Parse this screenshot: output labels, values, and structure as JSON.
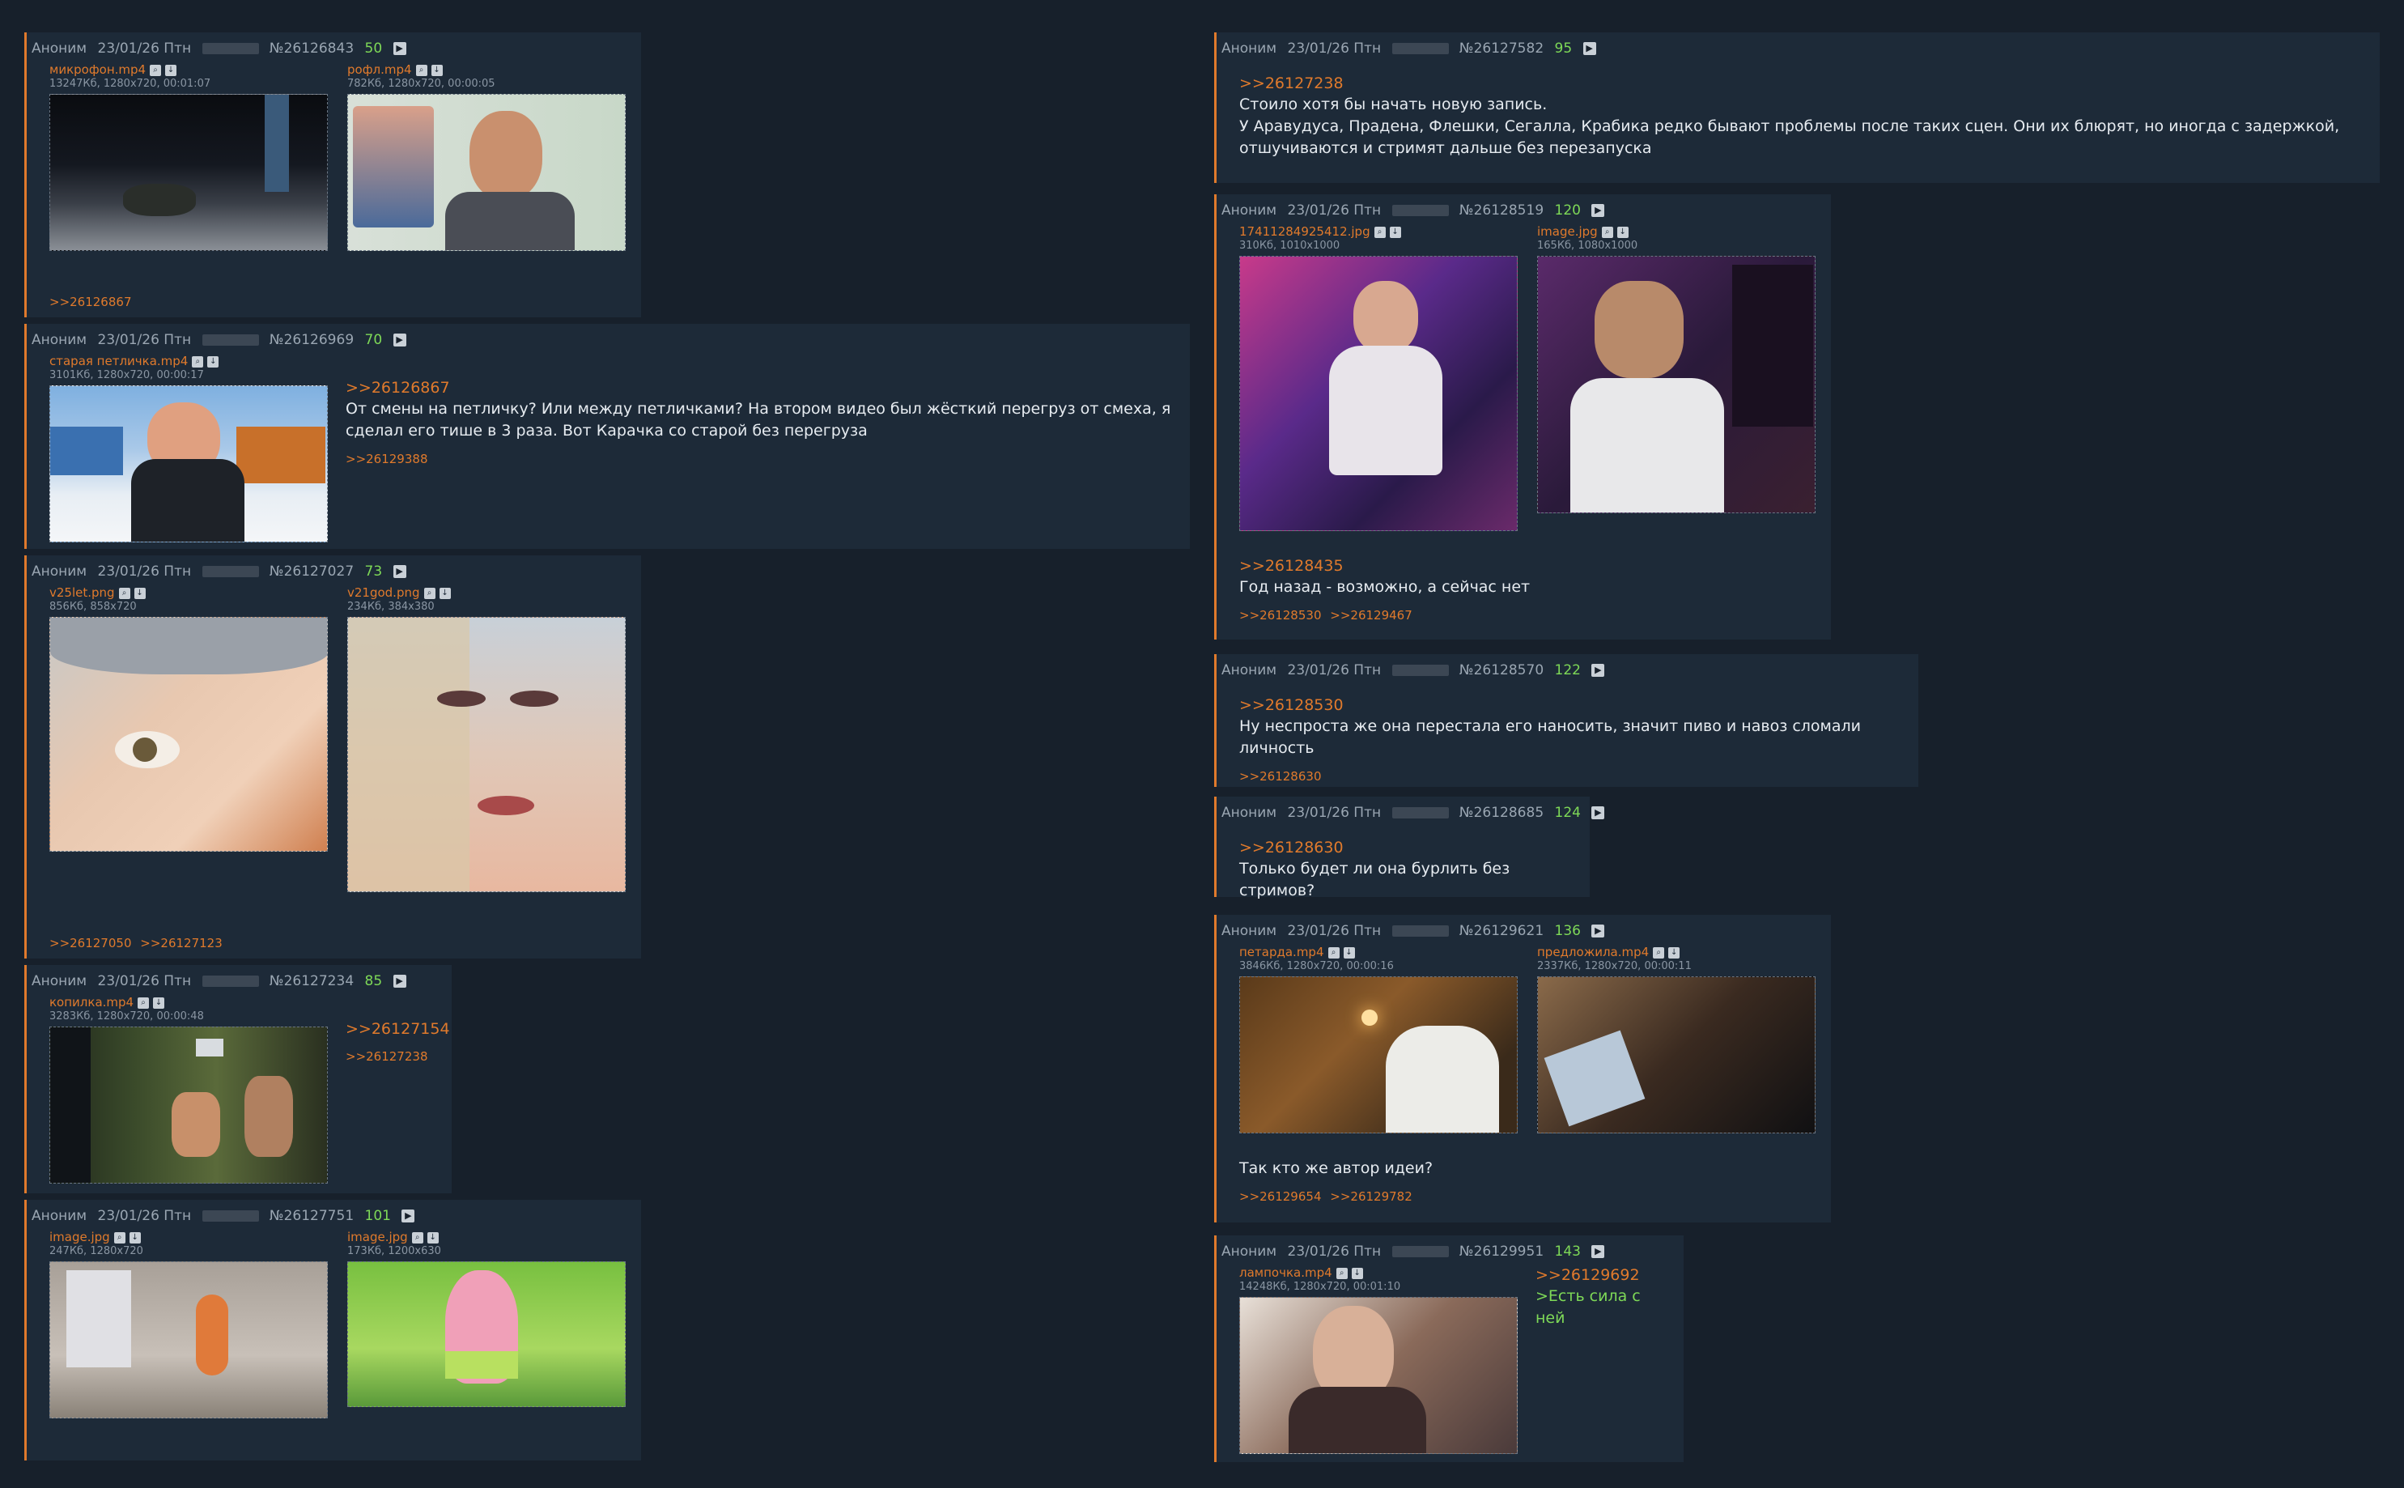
{
  "colors": {
    "accent": "#e07a2c",
    "green": "#7ed957",
    "bg": "#17202b",
    "post_bg": "#1d2a38"
  },
  "posts": [
    {
      "id": "p1",
      "author": "Аноним",
      "date": "23/01/26 Птн",
      "no": "№26126843",
      "count": "50",
      "files": [
        {
          "name": "микрофон.mp4",
          "meta": "13247Кб, 1280x720, 00:01:07"
        },
        {
          "name": "рофл.mp4",
          "meta": "782Кб, 1280x720, 00:00:05"
        }
      ],
      "backlinks": [
        ">>26126867"
      ]
    },
    {
      "id": "p2",
      "author": "Аноним",
      "date": "23/01/26 Птн",
      "no": "№26126969",
      "count": "70",
      "files": [
        {
          "name": "старая петличка.mp4",
          "meta": "3101Кб, 1280x720, 00:00:17"
        }
      ],
      "reply": ">>26126867",
      "text": [
        "От смены на петличку? Или между петличками? На втором видео был жёсткий перегруз от смеха, я",
        "сделал его тише в 3 раза. Вот Карачка со старой без перегруза"
      ],
      "backlinks": [
        ">>26129388"
      ]
    },
    {
      "id": "p3",
      "author": "Аноним",
      "date": "23/01/26 Птн",
      "no": "№26127027",
      "count": "73",
      "files": [
        {
          "name": "v25let.png",
          "meta": "856Кб, 858x720"
        },
        {
          "name": "v21god.png",
          "meta": "234Кб, 384x380"
        }
      ],
      "backlinks": [
        ">>26127050",
        ">>26127123"
      ]
    },
    {
      "id": "p4",
      "author": "Аноним",
      "date": "23/01/26 Птн",
      "no": "№26127234",
      "count": "85",
      "files": [
        {
          "name": "копилка.mp4",
          "meta": "3283Кб, 1280x720, 00:00:48"
        }
      ],
      "reply": ">>26127154",
      "backlinks": [
        ">>26127238"
      ]
    },
    {
      "id": "p5",
      "author": "Аноним",
      "date": "23/01/26 Птн",
      "no": "№26127751",
      "count": "101",
      "files": [
        {
          "name": "image.jpg",
          "meta": "247Кб, 1280x720"
        },
        {
          "name": "image.jpg",
          "meta": "173Кб, 1200x630"
        }
      ]
    },
    {
      "id": "p6",
      "author": "Аноним",
      "date": "23/01/26 Птн",
      "no": "№26127582",
      "count": "95",
      "reply": ">>26127238",
      "text": [
        "Стоило хотя бы начать новую запись.",
        "У Аравудуса, Прадена, Флешки, Сегалла, Крабика редко бывают проблемы после таких сцен. Они их блюрят, но иногда с задержкой,",
        "отшучиваются и стримят дальше без перезапуска"
      ]
    },
    {
      "id": "p7",
      "author": "Аноним",
      "date": "23/01/26 Птн",
      "no": "№26128519",
      "count": "120",
      "files": [
        {
          "name": "17411284925412.jpg",
          "meta": "310Кб, 1010x1000"
        },
        {
          "name": "image.jpg",
          "meta": "165Кб, 1080x1000"
        }
      ],
      "reply": ">>26128435",
      "text": [
        "Год назад - возможно, а сейчас нет"
      ],
      "backlinks": [
        ">>26128530",
        ">>26129467"
      ]
    },
    {
      "id": "p8",
      "author": "Аноним",
      "date": "23/01/26 Птн",
      "no": "№26128570",
      "count": "122",
      "reply": ">>26128530",
      "text": [
        "Ну неспроста же она перестала его наносить, значит пиво и навоз сломали личность"
      ],
      "backlinks": [
        ">>26128630"
      ]
    },
    {
      "id": "p9",
      "author": "Аноним",
      "date": "23/01/26 Птн",
      "no": "№26128685",
      "count": "124",
      "reply": ">>26128630",
      "text": [
        "Только будет ли она бурлить без стримов?"
      ]
    },
    {
      "id": "p10",
      "author": "Аноним",
      "date": "23/01/26 Птн",
      "no": "№26129621",
      "count": "136",
      "files": [
        {
          "name": "петарда.mp4",
          "meta": "3846Кб, 1280x720, 00:00:16"
        },
        {
          "name": "предложила.mp4",
          "meta": "2337Кб, 1280x720, 00:00:11"
        }
      ],
      "text": [
        "Так кто же автор идеи?"
      ],
      "backlinks": [
        ">>26129654",
        ">>26129782"
      ]
    },
    {
      "id": "p11",
      "author": "Аноним",
      "date": "23/01/26 Птн",
      "no": "№26129951",
      "count": "143",
      "files": [
        {
          "name": "лампочка.mp4",
          "meta": "14248Кб, 1280x720, 00:01:10"
        }
      ],
      "reply": ">>26129692",
      "greentext": ">Есть сила с ней"
    }
  ]
}
